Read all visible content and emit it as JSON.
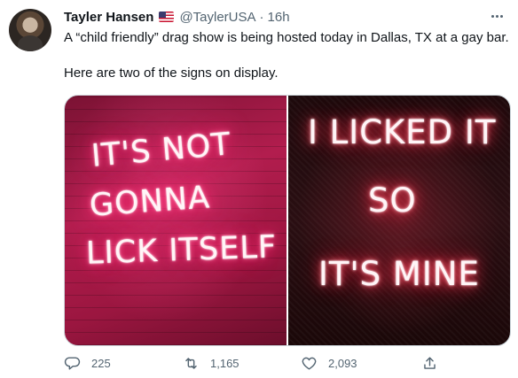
{
  "tweet": {
    "display_name": "Tayler Hansen",
    "flag_icon": "us-flag-icon",
    "handle": "@TaylerUSA",
    "separator": "·",
    "time": "16h",
    "text_line1": "A “child friendly” drag show is being hosted today in Dallas, TX at a gay bar.",
    "text_line2": "Here are two of the signs on display.",
    "media": {
      "left_sign": [
        "IT'S NOT",
        "GONNA",
        "LICK ITSELF"
      ],
      "right_sign": [
        "I LICKED IT",
        "SO",
        "IT'S MINE"
      ]
    },
    "actions": {
      "reply_count": "225",
      "retweet_count": "1,165",
      "like_count": "2,093"
    }
  },
  "colors": {
    "text_primary": "#0f1419",
    "text_secondary": "#536471",
    "border": "#cfd9de",
    "neon_pink": "#ff2f75"
  }
}
